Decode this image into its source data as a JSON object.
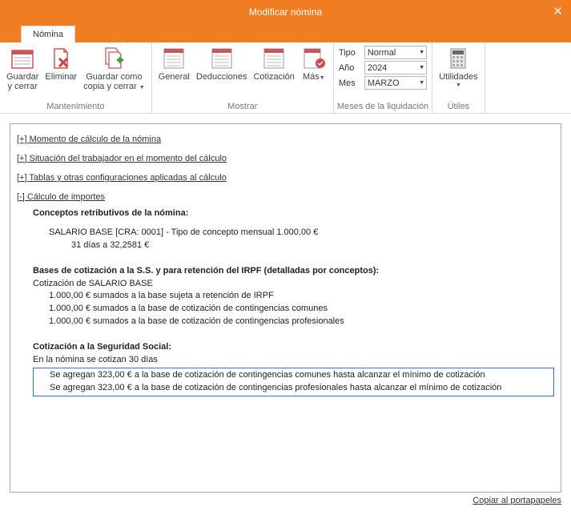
{
  "window": {
    "title": "Modificar nómina"
  },
  "tabs": {
    "active": "Nómina"
  },
  "ribbon": {
    "mantenimiento": {
      "label": "Mantenimiento",
      "save_close": "Guardar\ny cerrar",
      "delete": "Eliminar",
      "save_copy": "Guardar como\ncopia y cerrar"
    },
    "mostrar": {
      "label": "Mostrar",
      "general": "General",
      "deducciones": "Deducciones",
      "cotizacion": "Cotización",
      "mas": "Más"
    },
    "liquidacion": {
      "label": "Meses de la liquidación",
      "tipo_label": "Tipo",
      "tipo_value": "Normal",
      "anio_label": "Año",
      "anio_value": "2024",
      "mes_label": "Mes",
      "mes_value": "MARZO"
    },
    "utiles": {
      "label": "Útiles",
      "utilidades": "Utilidades"
    }
  },
  "body": {
    "link_momento": "[+] Momento de cálculo de la nómina",
    "link_situacion": "[+] Situación del trabajador en el momento del cálculo",
    "link_tablas": "[+] Tablas y otras configuraciones aplicadas al cálculo",
    "link_calc": "[-] Cálculo de importes",
    "conceptos_title": "Conceptos retributivos de la nómina:",
    "salario_line1": "SALARIO BASE [CRA: 0001] - Tipo de concepto mensual 1.000,00 €",
    "salario_line2": "31 días a 32,2581 €",
    "bases_title": "Bases de cotización a la S.S. y para retención del IRPF (detalladas por conceptos):",
    "cot_salario": "Cotización de SALARIO BASE",
    "cot1": "1.000,00 € sumados a la base sujeta a retención de IRPF",
    "cot2": "1.000,00 € sumados a la base de cotización de contingencias comunes",
    "cot3": "1.000,00 € sumados a la base de cotización de contingencias profesionales",
    "cot_ss_title": "Cotización a la Seguridad Social:",
    "cot_dias": "En la nómina se cotizan 30 días",
    "agr1": "Se agregan 323,00 € a la base de cotización de contingencias comunes hasta alcanzar el mínimo de cotización",
    "agr2": "Se agregan 323,00 € a la base de cotización de contingencias profesionales hasta alcanzar el mínimo de cotización",
    "copy": "Copiar al portapapeles"
  }
}
